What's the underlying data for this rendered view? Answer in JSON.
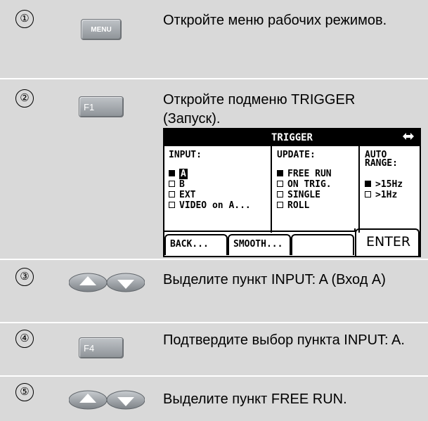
{
  "steps": [
    {
      "num": "①",
      "key": "MENU",
      "text": "Откройте меню рабочих режимов."
    },
    {
      "num": "②",
      "key": "F1",
      "text": "Откройте подменю TRIGGER (Запуск)."
    },
    {
      "num": "③",
      "key_icon": "up-down-arrow-keys",
      "text": "Выделите пункт INPUT: A (Вход A)"
    },
    {
      "num": "④",
      "key": "F4",
      "text": "Подтвердите выбор пункта INPUT: A."
    },
    {
      "num": "⑤",
      "key_icon": "up-down-arrow-keys",
      "text": "Выделите пункт FREE RUN."
    }
  ],
  "screen": {
    "title": "TRIGGER",
    "nav_icon": "◆",
    "input": {
      "heading": "INPUT:",
      "options": [
        {
          "label": "A",
          "checked": true,
          "highlighted": true
        },
        {
          "label": "B",
          "checked": false
        },
        {
          "label": "EXT",
          "checked": false
        },
        {
          "label": "VIDEO on A...",
          "checked": false
        }
      ]
    },
    "update": {
      "heading": "UPDATE:",
      "options": [
        {
          "label": "FREE RUN",
          "checked": true
        },
        {
          "label": "ON TRIG.",
          "checked": false
        },
        {
          "label": "SINGLE",
          "checked": false
        },
        {
          "label": "ROLL",
          "checked": false
        }
      ]
    },
    "autorange": {
      "heading_line1": "AUTO",
      "heading_line2": "RANGE:",
      "options": [
        {
          "label": ">15Hz",
          "checked": true
        },
        {
          "label": ">1Hz",
          "checked": false
        }
      ]
    },
    "softkeys": [
      "BACK...",
      "SMOOTH...",
      "",
      "ENTER"
    ]
  },
  "colors": {
    "row_bg": "#d9d9d9",
    "key_face": "#a8acb0",
    "screen_bg": "#ffffff"
  }
}
